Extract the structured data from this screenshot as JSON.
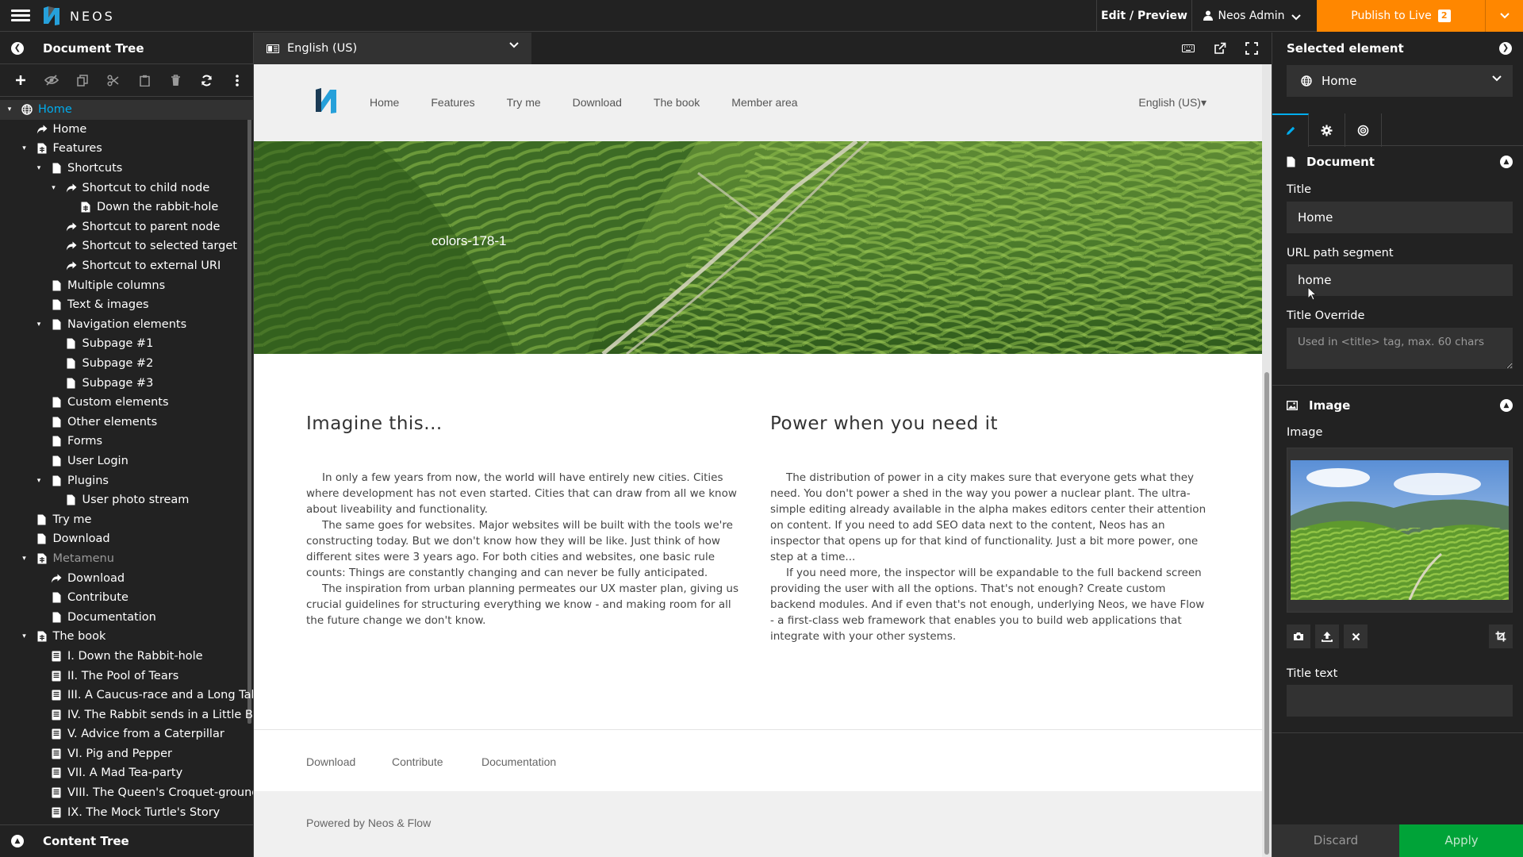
{
  "topbar": {
    "brand": "NEOS",
    "edit_preview": "Edit / Preview",
    "user": "Neos Admin",
    "publish": "Publish to Live",
    "publish_count": "2",
    "accent": "#ff8700"
  },
  "left": {
    "title": "Document Tree",
    "content_tree": "Content Tree",
    "tree": [
      {
        "label": "Home",
        "level": 0,
        "icon": "globe",
        "toggle": "open",
        "active": true
      },
      {
        "label": "Home",
        "level": 1,
        "icon": "shortcut"
      },
      {
        "label": "Features",
        "level": 1,
        "icon": "document-special",
        "toggle": "open"
      },
      {
        "label": "Shortcuts",
        "level": 2,
        "icon": "file",
        "toggle": "open"
      },
      {
        "label": "Shortcut to child node",
        "level": 3,
        "icon": "shortcut",
        "toggle": "open"
      },
      {
        "label": "Down the rabbit-hole",
        "level": 4,
        "icon": "document-special"
      },
      {
        "label": "Shortcut to parent node",
        "level": 3,
        "icon": "shortcut"
      },
      {
        "label": "Shortcut to selected target",
        "level": 3,
        "icon": "shortcut"
      },
      {
        "label": "Shortcut to external URI",
        "level": 3,
        "icon": "shortcut"
      },
      {
        "label": "Multiple columns",
        "level": 2,
        "icon": "file"
      },
      {
        "label": "Text & images",
        "level": 2,
        "icon": "file"
      },
      {
        "label": "Navigation elements",
        "level": 2,
        "icon": "file",
        "toggle": "open"
      },
      {
        "label": "Subpage #1",
        "level": 3,
        "icon": "file"
      },
      {
        "label": "Subpage #2",
        "level": 3,
        "icon": "file"
      },
      {
        "label": "Subpage #3",
        "level": 3,
        "icon": "file"
      },
      {
        "label": "Custom elements",
        "level": 2,
        "icon": "file"
      },
      {
        "label": "Other elements",
        "level": 2,
        "icon": "file"
      },
      {
        "label": "Forms",
        "level": 2,
        "icon": "file"
      },
      {
        "label": "User Login",
        "level": 2,
        "icon": "file"
      },
      {
        "label": "Plugins",
        "level": 2,
        "icon": "file",
        "toggle": "open"
      },
      {
        "label": "User photo stream",
        "level": 3,
        "icon": "file"
      },
      {
        "label": "Try me",
        "level": 1,
        "icon": "file"
      },
      {
        "label": "Download",
        "level": 1,
        "icon": "file"
      },
      {
        "label": "Metamenu",
        "level": 1,
        "icon": "document-special",
        "toggle": "open",
        "muted": true
      },
      {
        "label": "Download",
        "level": 2,
        "icon": "shortcut"
      },
      {
        "label": "Contribute",
        "level": 2,
        "icon": "file"
      },
      {
        "label": "Documentation",
        "level": 2,
        "icon": "file"
      },
      {
        "label": "The book",
        "level": 1,
        "icon": "document-special",
        "toggle": "open"
      },
      {
        "label": "I. Down the Rabbit-hole",
        "level": 2,
        "icon": "book"
      },
      {
        "label": "II. The Pool of Tears",
        "level": 2,
        "icon": "book"
      },
      {
        "label": "III. A Caucus-race and a Long Tale",
        "level": 2,
        "icon": "book"
      },
      {
        "label": "IV. The Rabbit sends in a Little Bill",
        "level": 2,
        "icon": "book"
      },
      {
        "label": "V. Advice from a Caterpillar",
        "level": 2,
        "icon": "book"
      },
      {
        "label": "VI. Pig and Pepper",
        "level": 2,
        "icon": "book"
      },
      {
        "label": "VII. A Mad Tea-party",
        "level": 2,
        "icon": "book"
      },
      {
        "label": "VIII. The Queen's Croquet-ground",
        "level": 2,
        "icon": "book"
      },
      {
        "label": "IX. The Mock Turtle's Story",
        "level": 2,
        "icon": "book"
      }
    ]
  },
  "center": {
    "dimension": "English (US)"
  },
  "site": {
    "nav": [
      "Home",
      "Features",
      "Try me",
      "Download",
      "The book",
      "Member area"
    ],
    "language": "English (US)▾",
    "hero_caption": "colors-178-1",
    "col1_title": "Imagine this...",
    "col1_paragraphs": [
      "In only a few years from now, the world will have entirely new cities. Cities where development has not even started. Cities that can draw from all we know about liveability and functionality.",
      "The same goes for websites. Major websites will be built with the tools we're constructing today. But we don't know how they will be like. Just think of how different sites were 3 years ago. For both cities and websites, one basic rule counts: Things are constantly changing and can never be fully anticipated.",
      "The inspiration from urban planning permeates our UX master plan, giving us crucial guidelines for structuring everything we know  - and making room for all the future change we don't know."
    ],
    "col2_title": "Power when you need it",
    "col2_paragraphs": [
      "The distribution of power in a city makes sure that everyone gets what they need. You don't power a shed in the way you power a nuclear plant. The ultra-simple editing already available in the alpha makes editors center their attention on content. If you need to add SEO data next to the content, Neos has an inspector that opens up for that kind of functionality. Just a bit more power, one step at a time...",
      "If you need more, the inspector will be expandable to the full backend screen providing the user with all the options. That's not enough? Create custom backend modules. And if even that's not enough, underlying Neos, we have Flow - a first-class web framework that enables you to build web applications that integrate with your other systems."
    ],
    "footer_links": [
      "Download",
      "Contribute",
      "Documentation"
    ],
    "powered_by": "Powered by Neos & Flow"
  },
  "inspector": {
    "title": "Selected element",
    "selected": "Home",
    "document_section": "Document",
    "title_label": "Title",
    "title_value": "Home",
    "url_label": "URL path segment",
    "url_value": "home",
    "override_label": "Title Override",
    "override_placeholder": "Used in <title> tag, max. 60 chars",
    "image_section": "Image",
    "image_label": "Image",
    "title_text_label": "Title text",
    "title_text_value": "",
    "discard": "Discard",
    "apply": "Apply",
    "apply_color": "#00a338",
    "accent": "#00adee"
  }
}
